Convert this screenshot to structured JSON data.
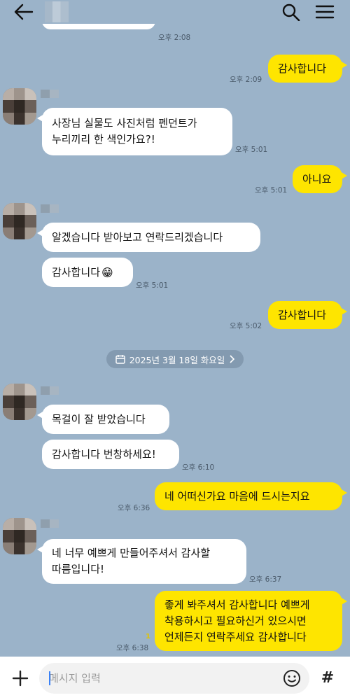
{
  "header": {
    "back_icon": "arrow-left-icon",
    "search_icon": "search-icon",
    "menu_icon": "hamburger-menu-icon"
  },
  "messages": [
    {
      "side": "in",
      "text": "",
      "time": "오후 2:08"
    },
    {
      "side": "out",
      "text": "감사합니다",
      "time": "오후 2:09"
    },
    {
      "side": "in",
      "lines": [
        "사장님 실물도 사진처럼 펜던트가",
        "누리끼리 한 색인가요?!"
      ],
      "time": "오후 5:01"
    },
    {
      "side": "out",
      "text": "아니요",
      "time": "오후 5:01"
    },
    {
      "side": "in",
      "text": "알겠습니다 받아보고 연락드리겠습니다"
    },
    {
      "side": "in",
      "text": "감사합니다",
      "emoji": "😁",
      "time": "오후 5:01"
    },
    {
      "side": "out",
      "text": "감사합니다",
      "time": "오후 5:02"
    },
    {
      "side": "in",
      "text": "목걸이 잘 받았습니다"
    },
    {
      "side": "in",
      "text": "감사합니다 번창하세요!",
      "time": "오후 6:10"
    },
    {
      "side": "out",
      "text": "네 어떠신가요 마음에 드시는지요",
      "time": "오후 6:36"
    },
    {
      "side": "in",
      "lines": [
        "네 너무 예쁘게 만들어주셔서 감사할",
        "따름입니다!"
      ],
      "time": "오후 6:37"
    },
    {
      "side": "out",
      "lines": [
        "좋게 봐주셔서 감사합니다 예쁘게",
        "착용하시고 필요하신거 있으시면",
        "언제든지 연락주세요 감사합니다"
      ],
      "time": "오후 6:38",
      "unread": "1"
    }
  ],
  "date_divider": "2025년 3월 18일 화요일",
  "input": {
    "placeholder": "메시지 입력",
    "plus_icon": "plus-icon",
    "emoji_icon": "smiley-icon",
    "hash_label": "#"
  },
  "colors": {
    "background": "#9bb3c9",
    "out_bubble": "#fee500",
    "in_bubble": "#ffffff"
  }
}
